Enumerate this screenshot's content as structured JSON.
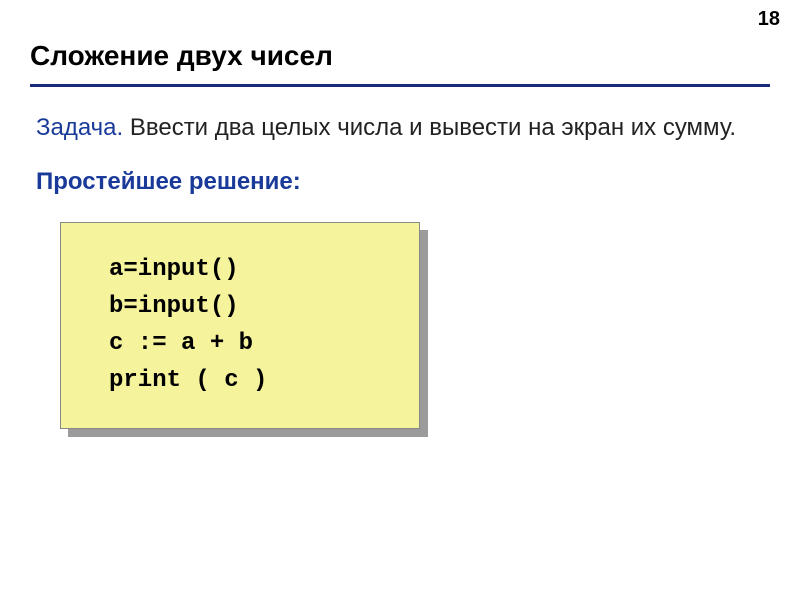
{
  "page_number": "18",
  "title": "Сложение двух чисел",
  "task": {
    "label": "Задача.",
    "text": " Ввести два целых числа и вывести на экран их сумму."
  },
  "solution_label": "Простейшее решение:",
  "code": {
    "line1": "a=input()",
    "line2": "b=input()",
    "line3": "c := a + b",
    "line4": "print ( c )"
  }
}
